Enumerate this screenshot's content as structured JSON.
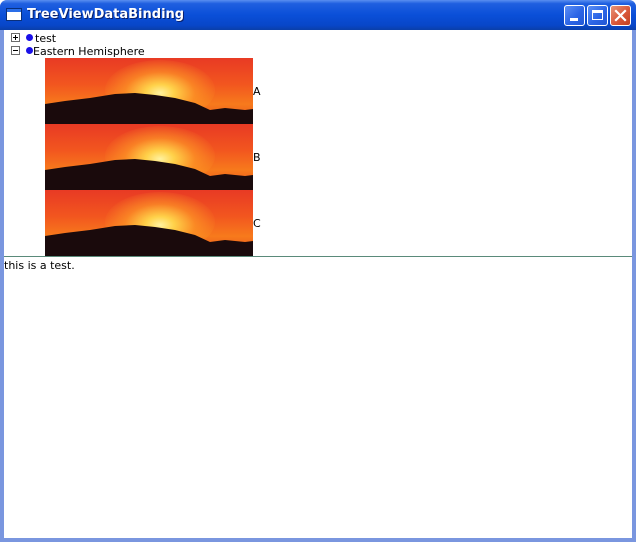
{
  "window": {
    "title": "TreeViewDataBinding",
    "icons": [
      "app-window-icon",
      "minimize-icon",
      "maximize-icon",
      "close-icon"
    ],
    "colors": {
      "titlebar": "#0a4fd8",
      "close": "#d9583a",
      "bullet": "#1a10e8"
    }
  },
  "tree": {
    "nodes": [
      {
        "label": "test",
        "expanded": false
      },
      {
        "label": "Eastern Hemisphere",
        "expanded": true,
        "children": [
          {
            "label": "A",
            "image": "sunset-image"
          },
          {
            "label": "B",
            "image": "sunset-image"
          },
          {
            "label": "C",
            "image": "sunset-image"
          }
        ]
      }
    ]
  },
  "detail": {
    "text": "this is a test."
  }
}
